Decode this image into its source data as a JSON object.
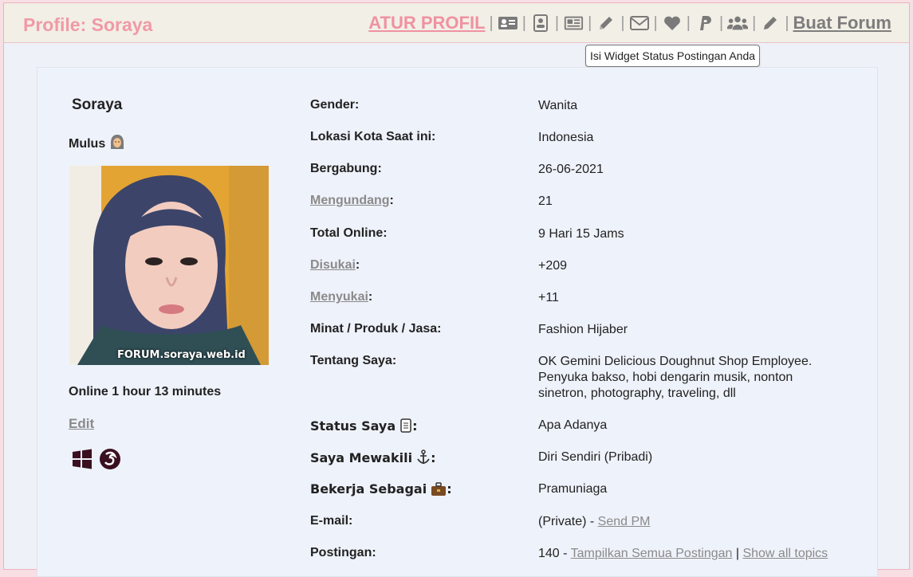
{
  "header": {
    "title": "Profile: Soraya",
    "atur_profil": "ATUR PROFIL",
    "buat_forum": "Buat Forum",
    "icons": [
      "id-card-icon",
      "contact-icon",
      "newspaper-icon",
      "pencil-icon",
      "envelope-icon",
      "heart-icon",
      "paypal-icon",
      "users-icon",
      "pencil-icon"
    ]
  },
  "tooltip": "Isi Widget Status Postingan Anda",
  "profile": {
    "name": "Soraya",
    "rank": "Mulus",
    "avatar_watermark": "FORUM.soraya.web.id",
    "online": "Online 1 hour 13 minutes",
    "edit": "Edit"
  },
  "fields": {
    "gender": {
      "label": "Gender:",
      "value": "Wanita"
    },
    "lokasi": {
      "label": "Lokasi Kota Saat ini:",
      "value": "Indonesia"
    },
    "bergabung": {
      "label": "Bergabung:",
      "value": "26-06-2021"
    },
    "mengundang": {
      "label": "Mengundang",
      "value": "21"
    },
    "total_online": {
      "label": "Total Online:",
      "value": "9 Hari 15 Jams"
    },
    "disukai": {
      "label": "Disukai",
      "value": "+209"
    },
    "menyukai": {
      "label": "Menyukai",
      "value": "+11"
    },
    "minat": {
      "label": "Minat / Produk / Jasa:",
      "value": "Fashion Hijaber"
    },
    "tentang": {
      "label": "Tentang Saya:",
      "value": "OK Gemini Delicious Doughnut Shop Employee. Penyuka bakso, hobi dengarin musik, nonton sinetron, photography, traveling, dll"
    },
    "status": {
      "label": "Status Saya",
      "value": "Apa Adanya"
    },
    "mewakili": {
      "label": "Saya Mewakili",
      "value": "Diri Sendiri (Pribadi)"
    },
    "bekerja": {
      "label": "Bekerja Sebagai",
      "value": "Pramuniaga"
    },
    "email": {
      "label": "E-mail:",
      "value": "(Private) - ",
      "link": "Send PM"
    },
    "postingan": {
      "label": "Postingan:",
      "value": "140 - ",
      "link1": "Tampilkan Semua Postingan",
      "sep": " | ",
      "link2": "Show all topics"
    }
  },
  "colors": {
    "accent": "#ef92a1",
    "link_gray": "#8a8a8a"
  }
}
